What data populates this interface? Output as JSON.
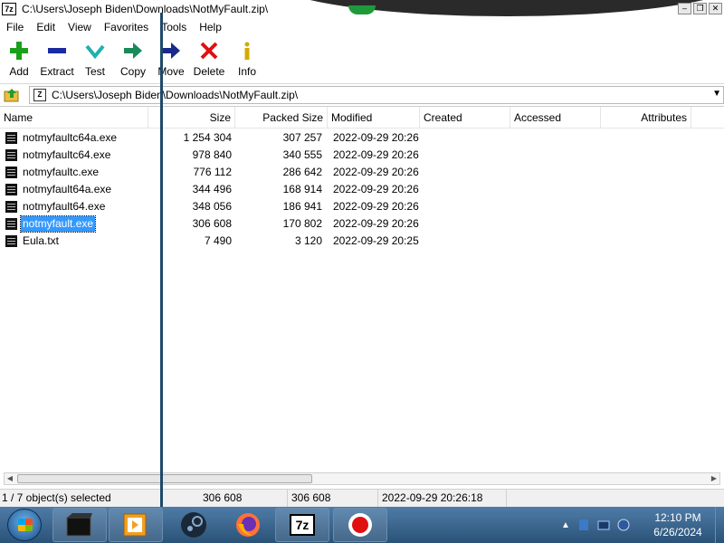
{
  "window": {
    "title": "C:\\Users\\Joseph Biden\\Downloads\\NotMyFault.zip\\",
    "app_icon": "7z"
  },
  "menu": [
    "File",
    "Edit",
    "View",
    "Favorites",
    "Tools",
    "Help"
  ],
  "toolbar": [
    {
      "label": "Add",
      "icon": "plus-icon",
      "color": "#1aa01a"
    },
    {
      "label": "Extract",
      "icon": "minus-icon",
      "color": "#1a2aa0"
    },
    {
      "label": "Test",
      "icon": "check-icon",
      "color": "#20b0b0"
    },
    {
      "label": "Copy",
      "icon": "copy-arrow-icon",
      "color": "#1a8a5a"
    },
    {
      "label": "Move",
      "icon": "move-arrow-icon",
      "color": "#1a2a8a"
    },
    {
      "label": "Delete",
      "icon": "x-icon",
      "color": "#e01010"
    },
    {
      "label": "Info",
      "icon": "info-icon",
      "color": "#d4a800"
    }
  ],
  "address": {
    "path": "C:\\Users\\Joseph Biden\\Downloads\\NotMyFault.zip\\",
    "icon": "zip-icon",
    "zip_label": "Z"
  },
  "columns": [
    "Name",
    "Size",
    "Packed Size",
    "Modified",
    "Created",
    "Accessed",
    "Attributes"
  ],
  "files": [
    {
      "name": "notmyfaultc64a.exe",
      "size": "1 254 304",
      "packed": "307 257",
      "modified": "2022-09-29 20:26"
    },
    {
      "name": "notmyfaultc64.exe",
      "size": "978 840",
      "packed": "340 555",
      "modified": "2022-09-29 20:26"
    },
    {
      "name": "notmyfaultc.exe",
      "size": "776 112",
      "packed": "286 642",
      "modified": "2022-09-29 20:26"
    },
    {
      "name": "notmyfault64a.exe",
      "size": "344 496",
      "packed": "168 914",
      "modified": "2022-09-29 20:26"
    },
    {
      "name": "notmyfault64.exe",
      "size": "348 056",
      "packed": "186 941",
      "modified": "2022-09-29 20:26"
    },
    {
      "name": "notmyfault.exe",
      "size": "306 608",
      "packed": "170 802",
      "modified": "2022-09-29 20:26",
      "selected": true
    },
    {
      "name": "Eula.txt",
      "size": "7 490",
      "packed": "3 120",
      "modified": "2022-09-29 20:25"
    }
  ],
  "status": {
    "selection": "1 / 7 object(s) selected",
    "size": "306 608",
    "packed": "306 608",
    "modified": "2022-09-29 20:26:18"
  },
  "taskbar": {
    "apps": [
      "explorer-icon",
      "media-player-icon",
      "steam-icon",
      "firefox-icon",
      "7zip-icon",
      "record-icon"
    ],
    "app_7z_label": "7z",
    "time": "12:10 PM",
    "date": "6/26/2024"
  },
  "colors": {
    "selection": "#3399ff",
    "taskbar": "#2b5278"
  }
}
